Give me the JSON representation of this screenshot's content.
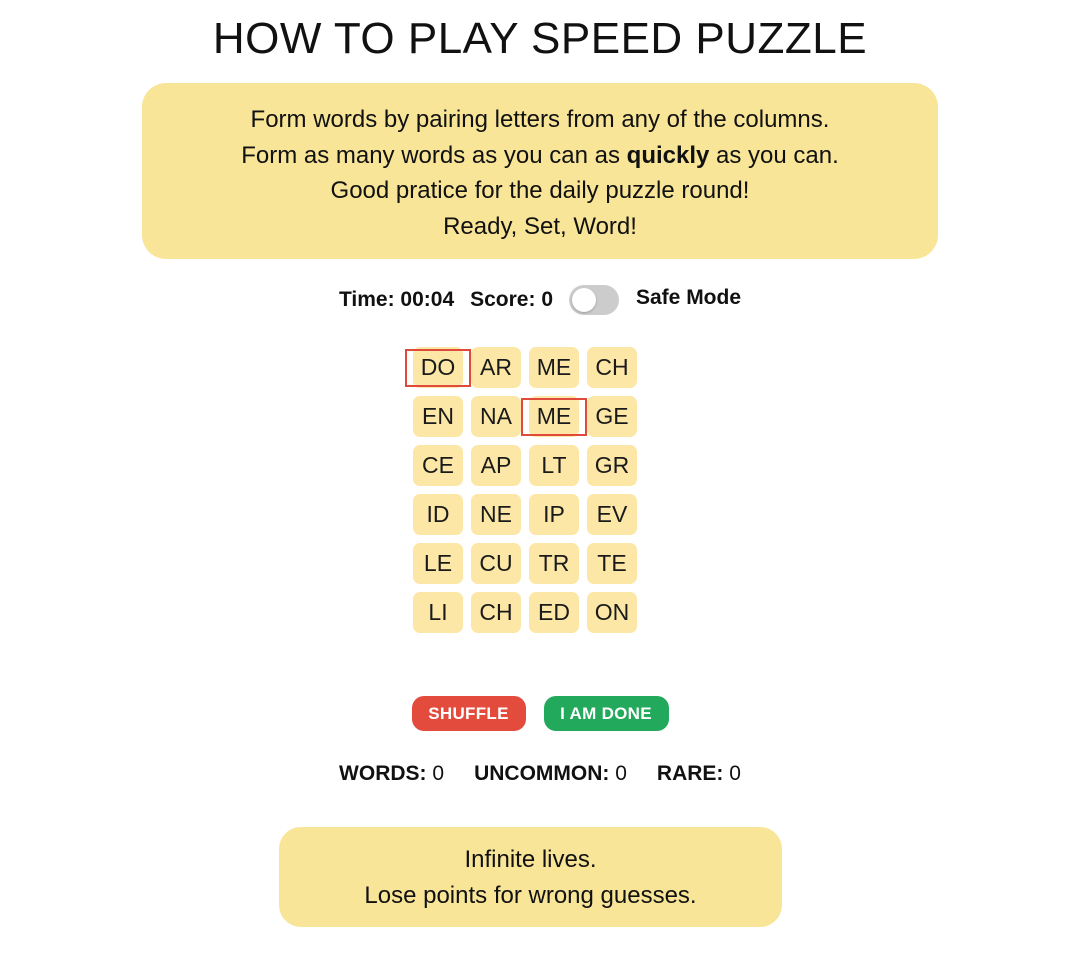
{
  "title": "HOW TO PLAY SPEED PUZZLE",
  "intro": {
    "line1": "Form words by pairing letters from any of the columns.",
    "line2_pre": "Form as many words as you can as ",
    "line2_bold": "quickly",
    "line2_post": " as you can.",
    "line3": "Good pratice for the daily puzzle round!",
    "line4": "Ready, Set, Word!"
  },
  "status": {
    "time_label": "Time: 00:04",
    "score_label": "Score: 0",
    "safe_mode_label": "Safe Mode",
    "safe_mode_on": false
  },
  "grid": {
    "rows": [
      [
        "DO",
        "AR",
        "ME",
        "CH"
      ],
      [
        "EN",
        "NA",
        "ME",
        "GE"
      ],
      [
        "CE",
        "AP",
        "LT",
        "GR"
      ],
      [
        "ID",
        "NE",
        "IP",
        "EV"
      ],
      [
        "LE",
        "CU",
        "TR",
        "TE"
      ],
      [
        "LI",
        "CH",
        "ED",
        "ON"
      ]
    ],
    "selected": [
      "DO",
      "ME"
    ]
  },
  "buttons": {
    "shuffle_label": "SHUFFLE",
    "done_label": "I AM DONE"
  },
  "counts": {
    "words_label": "WORDS:",
    "words_value": "0",
    "uncommon_label": "UNCOMMON:",
    "uncommon_value": "0",
    "rare_label": "RARE:",
    "rare_value": "0"
  },
  "info": {
    "line1": "Infinite lives.",
    "line2": "Lose points for wrong guesses."
  },
  "colors": {
    "panel": "#f8e597",
    "tile": "#fce7a6",
    "selected_border": "#e04a3a",
    "shuffle": "#e34b3d",
    "done": "#22a95b",
    "toggle_off": "#cccccc"
  }
}
